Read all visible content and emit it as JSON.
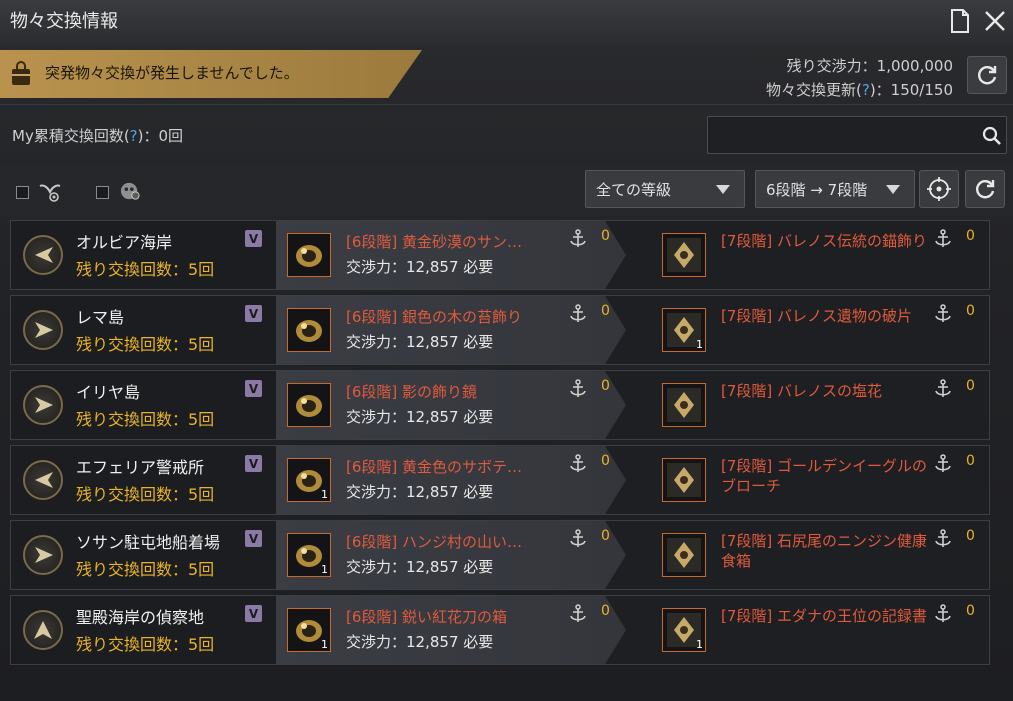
{
  "window": {
    "title": "物々交換情報"
  },
  "notice": {
    "text": "突発物々交換が発生しませんでした。"
  },
  "stats": {
    "remaining_power_label": "残り交渉力：1,000,000",
    "refresh_label_prefix": "物々交換更新(",
    "refresh_help": "?",
    "refresh_label_suffix": ")：150/150"
  },
  "mycount": {
    "prefix": "My累積交換回数(",
    "help": "?",
    "suffix": ")：0回"
  },
  "search": {
    "placeholder": ""
  },
  "filters": {
    "grade_dropdown": "全ての等級",
    "tier_dropdown": "6段階 → 7段階"
  },
  "rows": [
    {
      "location": "オルビア海岸",
      "remain": "残り交換回数：5回",
      "badge": "V",
      "give_name": "[6段階] 黄金砂漠のサン…",
      "give_cost": "交渉力：12,857 必要",
      "give_qty": "",
      "give_anchor": "0",
      "get_name": "[7段階] バレノス伝統の錨飾り",
      "get_qty": "",
      "get_anchor": "0"
    },
    {
      "location": "レマ島",
      "remain": "残り交換回数：5回",
      "badge": "V",
      "give_name": "[6段階] 銀色の木の苔飾り",
      "give_cost": "交渉力：12,857 必要",
      "give_qty": "",
      "give_anchor": "0",
      "get_name": "[7段階] バレノス遺物の破片",
      "get_qty": "1",
      "get_anchor": "0"
    },
    {
      "location": "イリヤ島",
      "remain": "残り交換回数：5回",
      "badge": "V",
      "give_name": "[6段階] 影の飾り鏡",
      "give_cost": "交渉力：12,857 必要",
      "give_qty": "",
      "give_anchor": "0",
      "get_name": "[7段階] バレノスの塩花",
      "get_qty": "",
      "get_anchor": "0"
    },
    {
      "location": "エフェリア警戒所",
      "remain": "残り交換回数：5回",
      "badge": "V",
      "give_name": "[6段階] 黄金色のサボテ…",
      "give_cost": "交渉力：12,857 必要",
      "give_qty": "1",
      "give_anchor": "0",
      "get_name": "[7段階] ゴールデンイーグルのブローチ",
      "get_qty": "",
      "get_anchor": "0"
    },
    {
      "location": "ソサン駐屯地船着場",
      "remain": "残り交換回数：5回",
      "badge": "V",
      "give_name": "[6段階] ハンジ村の山い…",
      "give_cost": "交渉力：12,857 必要",
      "give_qty": "1",
      "give_anchor": "0",
      "get_name": "[7段階] 石尻尾のニンジン健康食箱",
      "get_qty": "",
      "get_anchor": "0"
    },
    {
      "location": "聖殿海岸の偵察地",
      "remain": "残り交換回数：5回",
      "badge": "V",
      "give_name": "[6段階] 鋭い紅花刀の箱",
      "give_cost": "交渉力：12,857 必要",
      "give_qty": "1",
      "give_anchor": "0",
      "get_name": "[7段階] エダナの王位の記録書",
      "get_qty": "1",
      "get_anchor": "0"
    }
  ],
  "colors": {
    "accent_gold": "#e9b32a",
    "item_red": "#e05a3c",
    "help_blue": "#4ba3e8"
  },
  "icons": [
    "document-icon",
    "close-icon",
    "bag-icon",
    "refresh-icon",
    "search-icon",
    "locate-icon",
    "anchor-icon",
    "direction-arrow-icon"
  ]
}
